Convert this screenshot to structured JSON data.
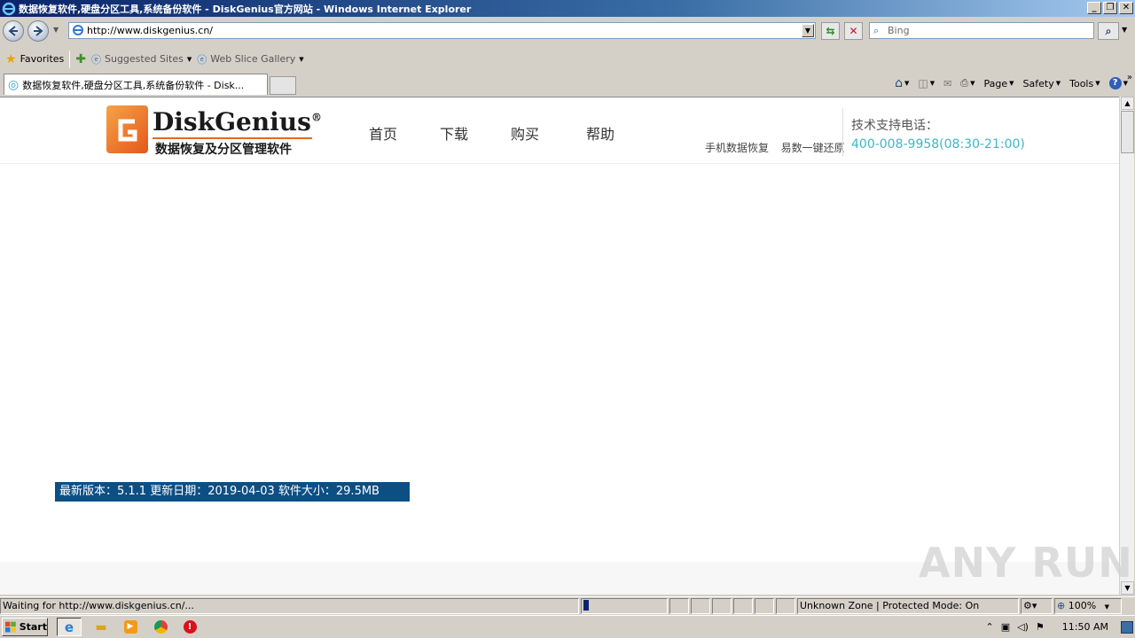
{
  "window": {
    "title": "数据恢复软件,硬盘分区工具,系统备份软件 - DiskGenius官方网站 - Windows Internet Explorer",
    "controls": [
      "_",
      "❐",
      "✕"
    ]
  },
  "address": {
    "url": "http://www.diskgenius.cn/",
    "search_placeholder": "Bing"
  },
  "favorites": {
    "favorites_label": "Favorites",
    "items": [
      "Suggested Sites",
      "Web Slice Gallery"
    ]
  },
  "tab": {
    "title": "数据恢复软件,硬盘分区工具,系统备份软件 - Disk..."
  },
  "commandbar": {
    "page": "Page",
    "safety": "Safety",
    "tools": "Tools"
  },
  "site": {
    "brand": "DiskGenius",
    "registered": "®",
    "tagline": "数据恢复及分区管理软件",
    "nav": [
      "首页",
      "下载",
      "购买",
      "帮助"
    ],
    "links": [
      "手机数据恢复",
      "易数一键还原"
    ],
    "support_label": "技术支持电话：",
    "support_phone": "400-008-9958(08:30-21:00)",
    "version_info": "最新版本：5.1.1 更新日期：2019-04-03 软件大小：29.5MB"
  },
  "watermark": "ANY RUN",
  "status": {
    "text": "Waiting for http://www.diskgenius.cn/...",
    "zone": "Unknown Zone | Protected Mode: On",
    "zoom": "100%"
  },
  "taskbar": {
    "start": "Start",
    "time": "11:50 AM"
  },
  "colors": {
    "accent_orange": "#e36a1e",
    "phone_teal": "#3fb6c6",
    "version_bar": "#0c4f85"
  }
}
